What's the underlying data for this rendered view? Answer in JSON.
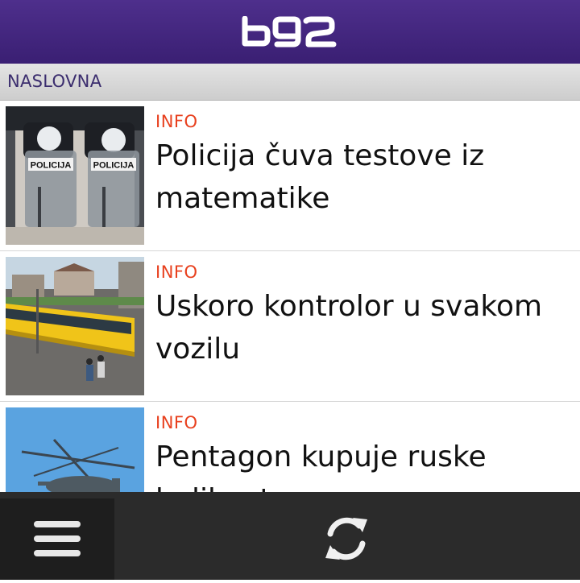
{
  "header": {
    "logo": "b92",
    "logo_icon": "b92-logo",
    "background": "#3e2279"
  },
  "section": {
    "title": "NASLOVNA"
  },
  "articles": [
    {
      "category": "INFO",
      "title": "Policija čuva testove iz matematike",
      "thumbnail_icon": "riot-police-photo",
      "shield_label": "POLICIJA"
    },
    {
      "category": "INFO",
      "title": "Uskoro kontrolor u svakom vozilu",
      "thumbnail_icon": "yellow-bus-photo"
    },
    {
      "category": "INFO",
      "title": "Pentagon kupuje ruske helikoptere",
      "thumbnail_icon": "helicopter-photo"
    }
  ],
  "bottom_bar": {
    "menu_icon": "hamburger-menu-icon",
    "refresh_icon": "refresh-icon"
  },
  "colors": {
    "accent_category": "#e8401e",
    "header_purple": "#3e2279",
    "section_text": "#3b2d6e",
    "toolbar": "#2b2b2b"
  }
}
